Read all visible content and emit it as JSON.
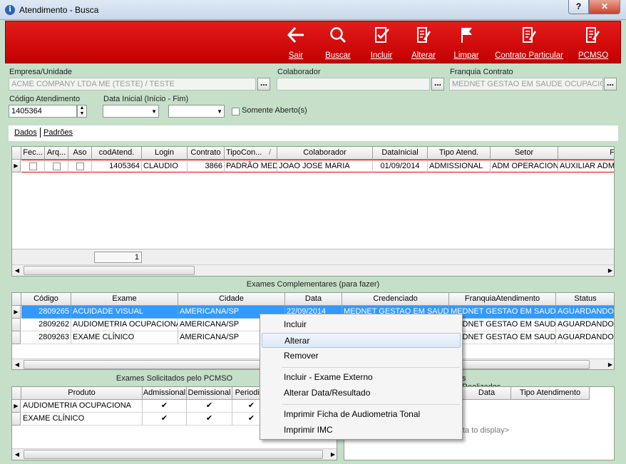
{
  "window": {
    "title": "Atendimento - Busca",
    "help": "?",
    "close": "✕"
  },
  "toolbar": [
    {
      "label": "Sair",
      "icon": "arrow-left-icon"
    },
    {
      "label": "Buscar",
      "icon": "search-icon"
    },
    {
      "label": "Incluir",
      "icon": "check-doc-icon"
    },
    {
      "label": "Alterar",
      "icon": "edit-doc-icon"
    },
    {
      "label": "Limpar",
      "icon": "flag-icon"
    },
    {
      "label": "Contrato Particular",
      "icon": "edit-doc-icon"
    },
    {
      "label": "PCMSO",
      "icon": "edit-doc-icon"
    }
  ],
  "form": {
    "empresa_label": "Empresa/Unidade",
    "empresa_value": "ACME COMPANY LTDA ME (TESTE) / TESTE",
    "colaborador_label": "Colaborador",
    "colaborador_value": "",
    "franquia_label": "Franquia Contrato",
    "franquia_value": "MEDNET GESTAO EM SAUDE OCUPACION",
    "codigo_label": "Código Atendimento",
    "codigo_value": "1405364",
    "data_label": "Data Inicial (Início - Fim)",
    "somente_label": "Somente Aberto(s)",
    "dots": "..."
  },
  "tabs": [
    "Dados",
    "Padrões"
  ],
  "atend_grid": {
    "headers": [
      "Fec...",
      "Arq...",
      "Aso",
      "codAtend.",
      "Login",
      "Contrato",
      "TipoCon...",
      "Colaborador",
      "DataInicial",
      "Tipo Atend.",
      "Setor",
      "F"
    ],
    "sort_glyph": "/",
    "row": [
      "",
      "",
      "",
      "1405364",
      "CLAUDIO",
      "3866",
      "PADRÃO MED",
      "JOAO JOSE MARIA",
      "01/09/2014",
      "ADMISSIONAL",
      "ADM OPERACION",
      "AUXILIAR ADM"
    ],
    "footer_count": "1"
  },
  "exames_title": "Exames Complementares (para fazer)",
  "exames_grid": {
    "headers": [
      "Código",
      "Exame",
      "Cidade",
      "Data",
      "Credenciado",
      "FranquiaAtendimento",
      "Status"
    ],
    "rows": [
      [
        "2809265",
        "ACUIDADE VISUAL",
        "AMERICANA/SP",
        "22/09/2014",
        "MEDNET GESTAO EM SAUD",
        "MEDNET GESTAO EM SAUD",
        "AGUARDANDO"
      ],
      [
        "2809262",
        "AUDIOMETRIA OCUPACIONA",
        "AMERICANA/SP",
        "",
        "",
        "MEDNET GESTAO EM SAUD",
        "AGUARDANDO"
      ],
      [
        "2809263",
        "EXAME CLÍNICO",
        "AMERICANA/SP",
        "",
        "",
        "MEDNET GESTAO EM SAUD",
        "AGUARDANDO"
      ]
    ]
  },
  "pcmso_title": "Exames Solicitados pelo PCMSO",
  "pcmso_grid": {
    "headers": [
      "Produto",
      "Admissional",
      "Demissional",
      "Periodico"
    ],
    "rows": [
      [
        "AUDIOMETRIA OCUPACIONA",
        "✔",
        "✔",
        "✔"
      ],
      [
        "EXAME CLÍNICO",
        "✔",
        "✔",
        "✔"
      ]
    ]
  },
  "realizados_title": "s Realizados",
  "realizados_grid": {
    "headers": [
      "Data",
      "Tipo Atendimento"
    ],
    "empty": "ta to display>"
  },
  "context_menu": [
    "Incluir",
    "Alterar",
    "Remover",
    "Incluir - Exame Externo",
    "Alterar Data/Resultado",
    "Imprimir Ficha de Audiometria Tonal",
    "Imprimir IMC"
  ],
  "colors": {
    "toolbar": "#d90a0a",
    "background": "#c5dfc8",
    "selection": "#3399ff"
  }
}
